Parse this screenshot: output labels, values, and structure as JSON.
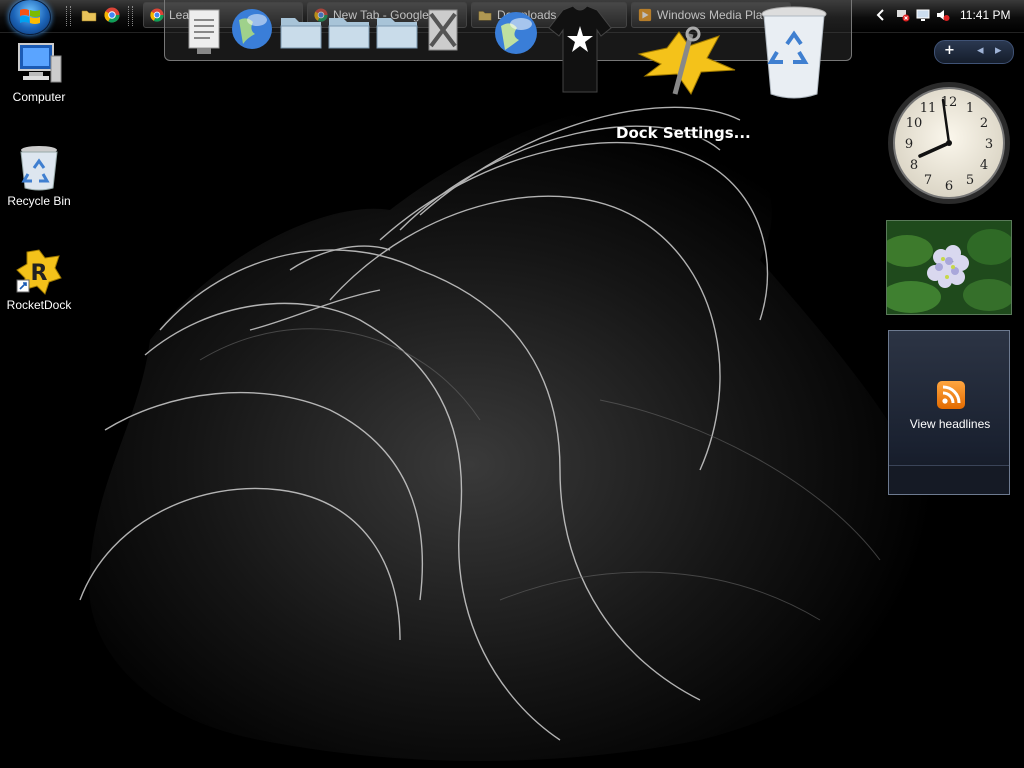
{
  "taskbar": {
    "tasks": [
      {
        "label": "Lead Set!",
        "icon": "chrome-icon"
      },
      {
        "label": "New Tab - Google C",
        "icon": "chrome-icon"
      },
      {
        "label": "Downloads",
        "icon": "folder-icon"
      },
      {
        "label": "Windows Media Pla",
        "icon": "media-player-icon"
      }
    ],
    "clock": "11:41 PM",
    "quick_launch": [
      "folder-icon",
      "chrome-icon"
    ]
  },
  "dock": {
    "tooltip": "Dock Settings...",
    "items": [
      "notepad-icon",
      "globe-icon",
      "folder-icon",
      "folder-icon",
      "folder-icon",
      "tools-icon",
      "globe-icon",
      "tshirt-icon",
      "settings-icon",
      "recycle-bin-icon"
    ]
  },
  "desktop": {
    "icons": [
      {
        "label": "Computer",
        "icon": "computer-icon"
      },
      {
        "label": "Recycle Bin",
        "icon": "recycle-bin-icon"
      },
      {
        "label": "RocketDock",
        "icon": "rocketdock-icon"
      }
    ]
  },
  "sidebar": {
    "add_symbol": "+",
    "prev_symbol": "◂",
    "next_symbol": "▸",
    "clock_numbers": [
      "12",
      "1",
      "2",
      "3",
      "4",
      "5",
      "6",
      "7",
      "8",
      "9",
      "10",
      "11"
    ],
    "feed_label": "View headlines"
  },
  "colors": {
    "accent": "#1c64b8",
    "rss": "#f28a1a",
    "taskbar": "#0c0c0c"
  }
}
